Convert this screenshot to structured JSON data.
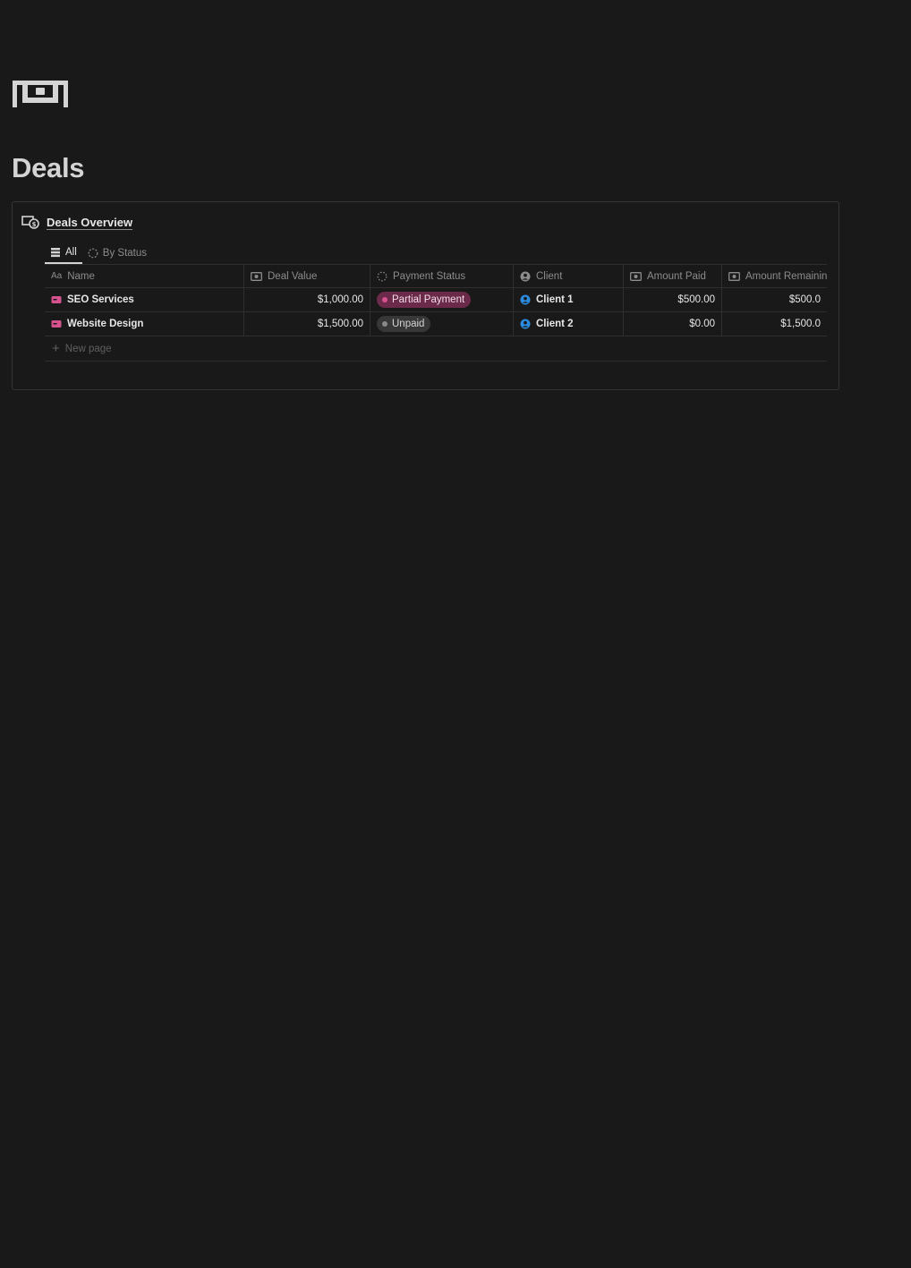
{
  "page": {
    "icon": "cash-icon",
    "title": "Deals"
  },
  "database": {
    "icon": "money-chart-icon",
    "title": "Deals Overview",
    "views": [
      {
        "label": "All",
        "icon": "table-icon",
        "active": true
      },
      {
        "label": "By Status",
        "icon": "status-icon",
        "active": false
      }
    ],
    "columns": [
      {
        "label": "Name",
        "icon": "text-icon"
      },
      {
        "label": "Deal Value",
        "icon": "money-icon"
      },
      {
        "label": "Payment Status",
        "icon": "status-icon"
      },
      {
        "label": "Client",
        "icon": "person-icon"
      },
      {
        "label": "Amount Paid",
        "icon": "money-icon"
      },
      {
        "label": "Amount Remainin",
        "icon": "money-icon"
      }
    ],
    "rows": [
      {
        "name": "SEO Services",
        "deal_value": "$1,000.00",
        "payment_status": {
          "label": "Partial Payment",
          "bg": "#6b2a4a",
          "dot": "#d5528f",
          "color": "#f2dce7"
        },
        "client": "Client 1",
        "amount_paid": "$500.00",
        "amount_remaining": "$500.0"
      },
      {
        "name": "Website Design",
        "deal_value": "$1,500.00",
        "payment_status": {
          "label": "Unpaid",
          "bg": "#373737",
          "dot": "#8a8a8a",
          "color": "#d4d4d4"
        },
        "client": "Client 2",
        "amount_paid": "$0.00",
        "amount_remaining": "$1,500.0"
      }
    ],
    "new_page_label": "New page"
  },
  "colors": {
    "background": "#191919",
    "row_icon": "#d5528f",
    "client_icon": "#2a8be0"
  }
}
